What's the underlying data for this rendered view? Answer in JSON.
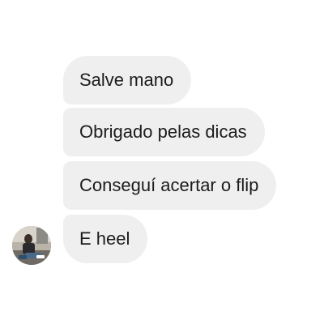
{
  "messages": [
    {
      "text": "Salve mano"
    },
    {
      "text": "Obrigado pelas dicas"
    },
    {
      "text": "Conseguí acertar o flip"
    },
    {
      "text": "E heel"
    }
  ],
  "colors": {
    "bubble_background": "#efefef",
    "bubble_text": "#1c1c1c",
    "page_background": "#ffffff"
  },
  "sender": {
    "avatar_icon": "user-photo-avatar"
  }
}
